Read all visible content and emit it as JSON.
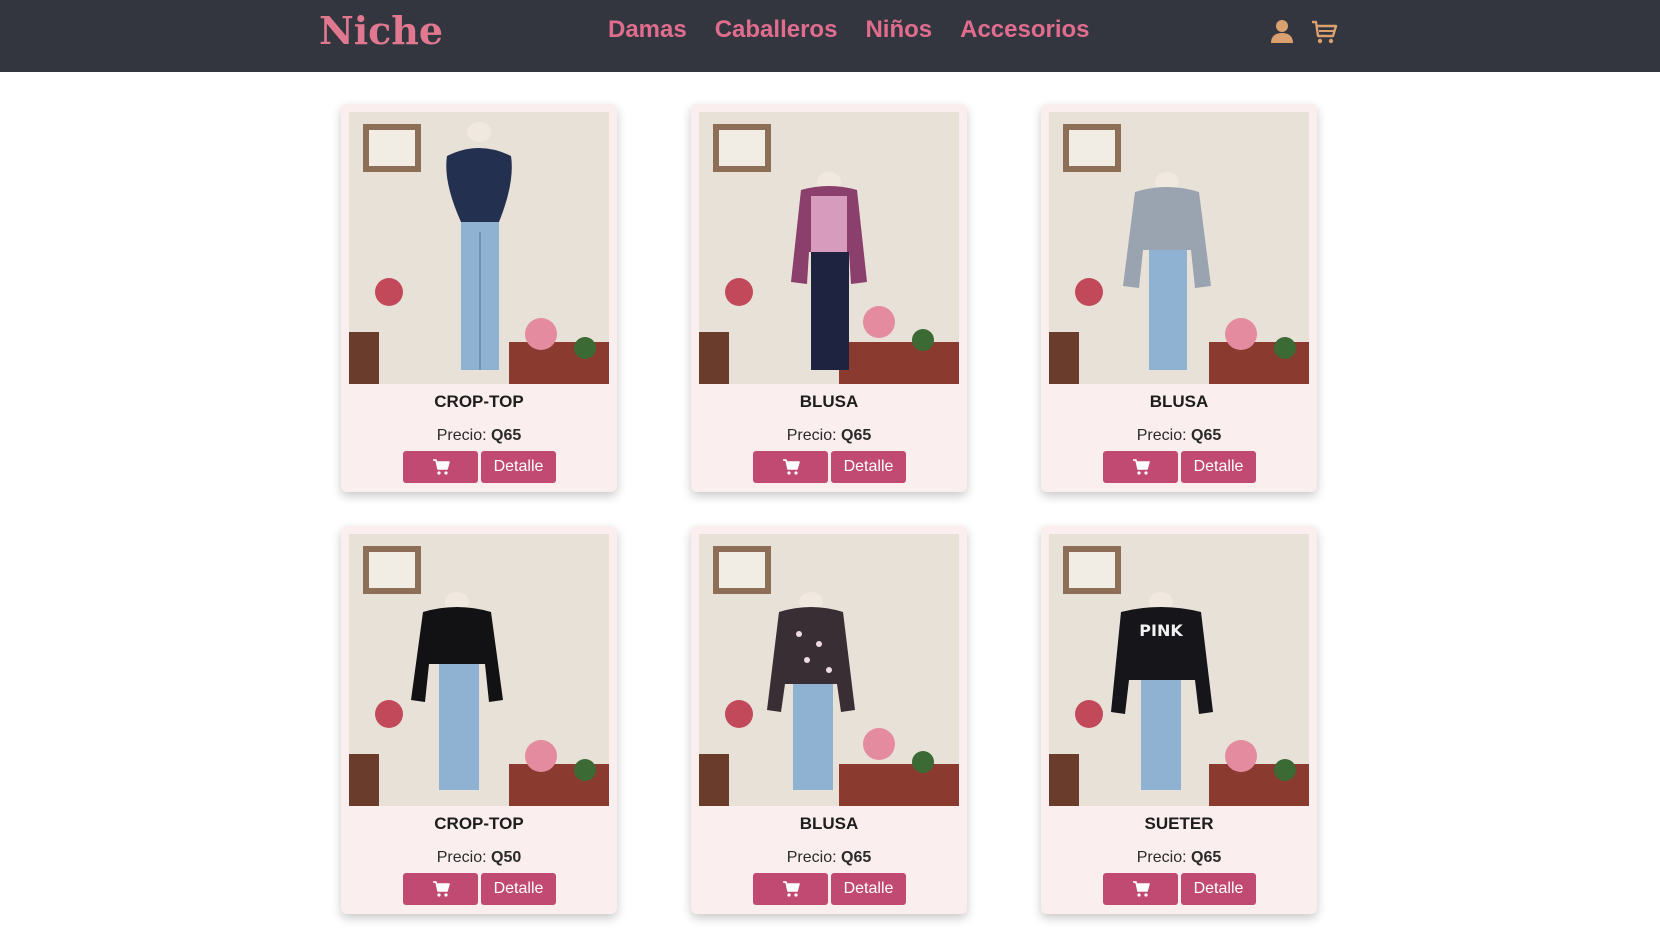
{
  "brand": {
    "logo": "Niche"
  },
  "nav": {
    "links": [
      "Damas",
      "Caballeros",
      "Niños",
      "Accesorios"
    ],
    "icons": [
      "user-icon",
      "cart-icon"
    ]
  },
  "colors": {
    "navbar_bg": "#34363f",
    "accent": "#e06d8d",
    "button": "#c04a72",
    "card_bg": "#fbeeee",
    "user_icon": "#d9a070"
  },
  "price_label": "Precio:",
  "detail_label": "Detalle",
  "products": [
    {
      "name": "CROP-TOP",
      "price": "Q65",
      "garment": "navy-polka-crop-top"
    },
    {
      "name": "BLUSA",
      "price": "Q65",
      "garment": "purple-raglan-blouse"
    },
    {
      "name": "BLUSA",
      "price": "Q65",
      "garment": "gray-twist-crop"
    },
    {
      "name": "CROP-TOP",
      "price": "Q50",
      "garment": "black-crop-top"
    },
    {
      "name": "BLUSA",
      "price": "Q65",
      "garment": "floral-blouse"
    },
    {
      "name": "SUETER",
      "price": "Q65",
      "garment": "black-pink-sweater"
    }
  ]
}
